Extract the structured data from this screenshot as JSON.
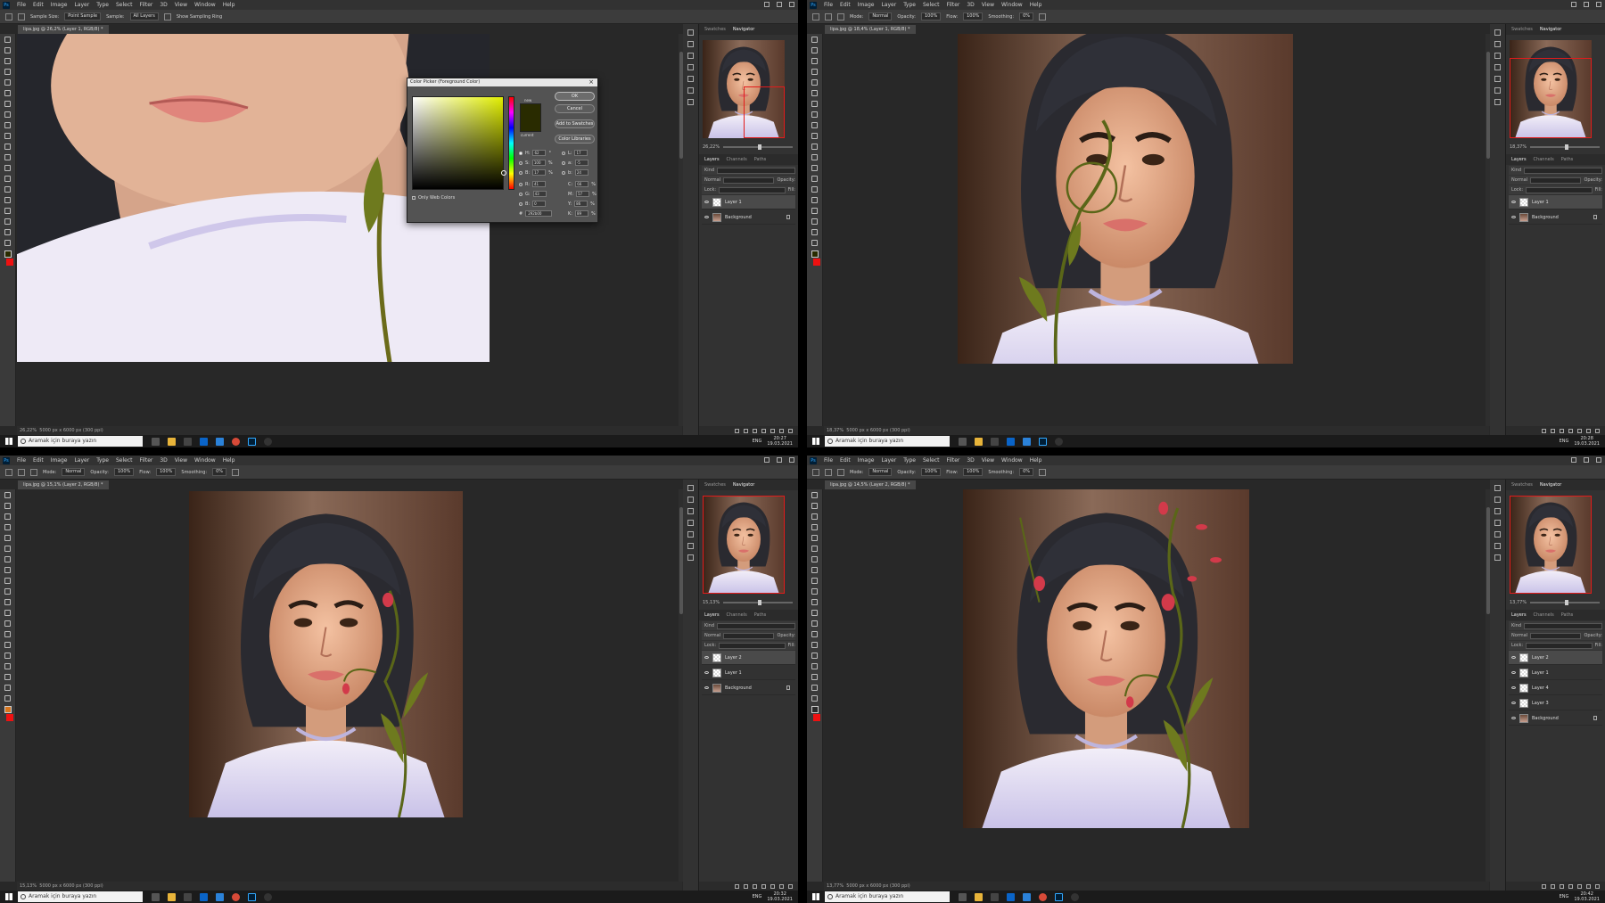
{
  "menu": [
    "File",
    "Edit",
    "Image",
    "Layer",
    "Type",
    "Select",
    "Filter",
    "3D",
    "View",
    "Window",
    "Help"
  ],
  "colors": {
    "foreground": "#292b00",
    "background": "#e21b1b",
    "navigator_frame": "#e21b1b"
  },
  "panel_tabs": {
    "swatches": "Swatches",
    "navigator": "Navigator"
  },
  "layers_tabs": {
    "layers": "Layers",
    "channels": "Channels",
    "paths": "Paths"
  },
  "layers_controls": {
    "kind": "Kind",
    "blend": "Normal",
    "opacity_label": "Opacity:",
    "opacity": "100%",
    "lock_label": "Lock:",
    "fill_label": "Fill:",
    "fill": "100%"
  },
  "taskbar": {
    "search_placeholder": "Aramak için buraya yazın",
    "lang": "ENG"
  },
  "quad1": {
    "options": {
      "sample_size_label": "Sample Size:",
      "sample_size": "Point Sample",
      "sample_label": "Sample:",
      "sample": "All Layers",
      "sampling_ring": "Show Sampling Ring"
    },
    "doc_tab": "lipa.jpg @ 26,2% (Layer 1, RGB/8) *",
    "zoom": "26,22%",
    "status": "5000 px x 6000 px (300 ppi)",
    "nav_zoom": "26,22%",
    "layers": [
      {
        "name": "Layer 1",
        "selected": true,
        "locked": false,
        "photo": false
      },
      {
        "name": "Background",
        "selected": false,
        "locked": true,
        "photo": true
      }
    ],
    "clock_time": "20:27",
    "clock_date": "19.03.2021"
  },
  "color_picker": {
    "title": "Color Picker (Foreground Color)",
    "ok": "OK",
    "cancel": "Cancel",
    "add_to_swatches": "Add to Swatches",
    "color_libraries": "Color Libraries",
    "new_label": "new",
    "current_label": "current",
    "only_web_colors": "Only Web Colors",
    "hsb": [
      {
        "k": "H:",
        "v": "62",
        "u": "°"
      },
      {
        "k": "S:",
        "v": "100",
        "u": "%"
      },
      {
        "k": "B:",
        "v": "17",
        "u": "%"
      }
    ],
    "rgb": [
      {
        "k": "R:",
        "v": "41"
      },
      {
        "k": "G:",
        "v": "43"
      },
      {
        "k": "B:",
        "v": "0"
      }
    ],
    "lab": [
      {
        "k": "L:",
        "v": "17"
      },
      {
        "k": "a:",
        "v": "-5"
      },
      {
        "k": "b:",
        "v": "24"
      }
    ],
    "cmyk": [
      {
        "k": "C:",
        "v": "66",
        "u": "%"
      },
      {
        "k": "M:",
        "v": "57",
        "u": "%"
      },
      {
        "k": "Y:",
        "v": "86",
        "u": "%"
      },
      {
        "k": "K:",
        "v": "89",
        "u": "%"
      }
    ],
    "hex_label": "#",
    "hex": "292b00"
  },
  "quad2": {
    "options": {
      "mode_label": "Mode:",
      "mode": "Normal",
      "opacity_label": "Opacity:",
      "opacity": "100%",
      "flow_label": "Flow:",
      "flow": "100%",
      "smoothing_label": "Smoothing:",
      "smoothing": "0%"
    },
    "doc_tab": "lipa.jpg @ 18,4% (Layer 1, RGB/8) *",
    "zoom": "18,37%",
    "status": "5000 px x 6000 px (300 ppi)",
    "nav_zoom": "18,37%",
    "layers": [
      {
        "name": "Layer 1",
        "selected": true,
        "locked": false,
        "photo": false
      },
      {
        "name": "Background",
        "selected": false,
        "locked": true,
        "photo": true
      }
    ],
    "clock_time": "20:28",
    "clock_date": "19.03.2021"
  },
  "quad3": {
    "options": {
      "mode_label": "Mode:",
      "mode": "Normal",
      "opacity_label": "Opacity:",
      "opacity": "100%",
      "flow_label": "Flow:",
      "flow": "100%",
      "smoothing_label": "Smoothing:",
      "smoothing": "0%"
    },
    "doc_tab": "lipa.jpg @ 15,1% (Layer 2, RGB/8) *",
    "zoom": "15,13%",
    "status": "5000 px x 6000 px (300 ppi)",
    "nav_zoom": "15,13%",
    "layers": [
      {
        "name": "Layer 2",
        "selected": true,
        "locked": false,
        "photo": false
      },
      {
        "name": "Layer 1",
        "selected": false,
        "locked": false,
        "photo": false
      },
      {
        "name": "Background",
        "selected": false,
        "locked": true,
        "photo": true
      }
    ],
    "clock_time": "20:32",
    "clock_date": "19.03.2021"
  },
  "quad4": {
    "options": {
      "mode_label": "Mode:",
      "mode": "Normal",
      "opacity_label": "Opacity:",
      "opacity": "100%",
      "flow_label": "Flow:",
      "flow": "100%",
      "smoothing_label": "Smoothing:",
      "smoothing": "0%"
    },
    "doc_tab": "lipa.jpg @ 14,5% (Layer 2, RGB/8) *",
    "zoom": "13,77%",
    "status": "5000 px x 6000 px (300 ppi)",
    "nav_zoom": "13,77%",
    "layers": [
      {
        "name": "Layer 2",
        "selected": true,
        "locked": false,
        "photo": false
      },
      {
        "name": "Layer 1",
        "selected": false,
        "locked": false,
        "photo": false
      },
      {
        "name": "Layer 4",
        "selected": false,
        "locked": false,
        "photo": false
      },
      {
        "name": "Layer 3",
        "selected": false,
        "locked": false,
        "photo": false
      },
      {
        "name": "Background",
        "selected": false,
        "locked": true,
        "photo": true
      }
    ],
    "clock_time": "20:42",
    "clock_date": "19.03.2021"
  }
}
